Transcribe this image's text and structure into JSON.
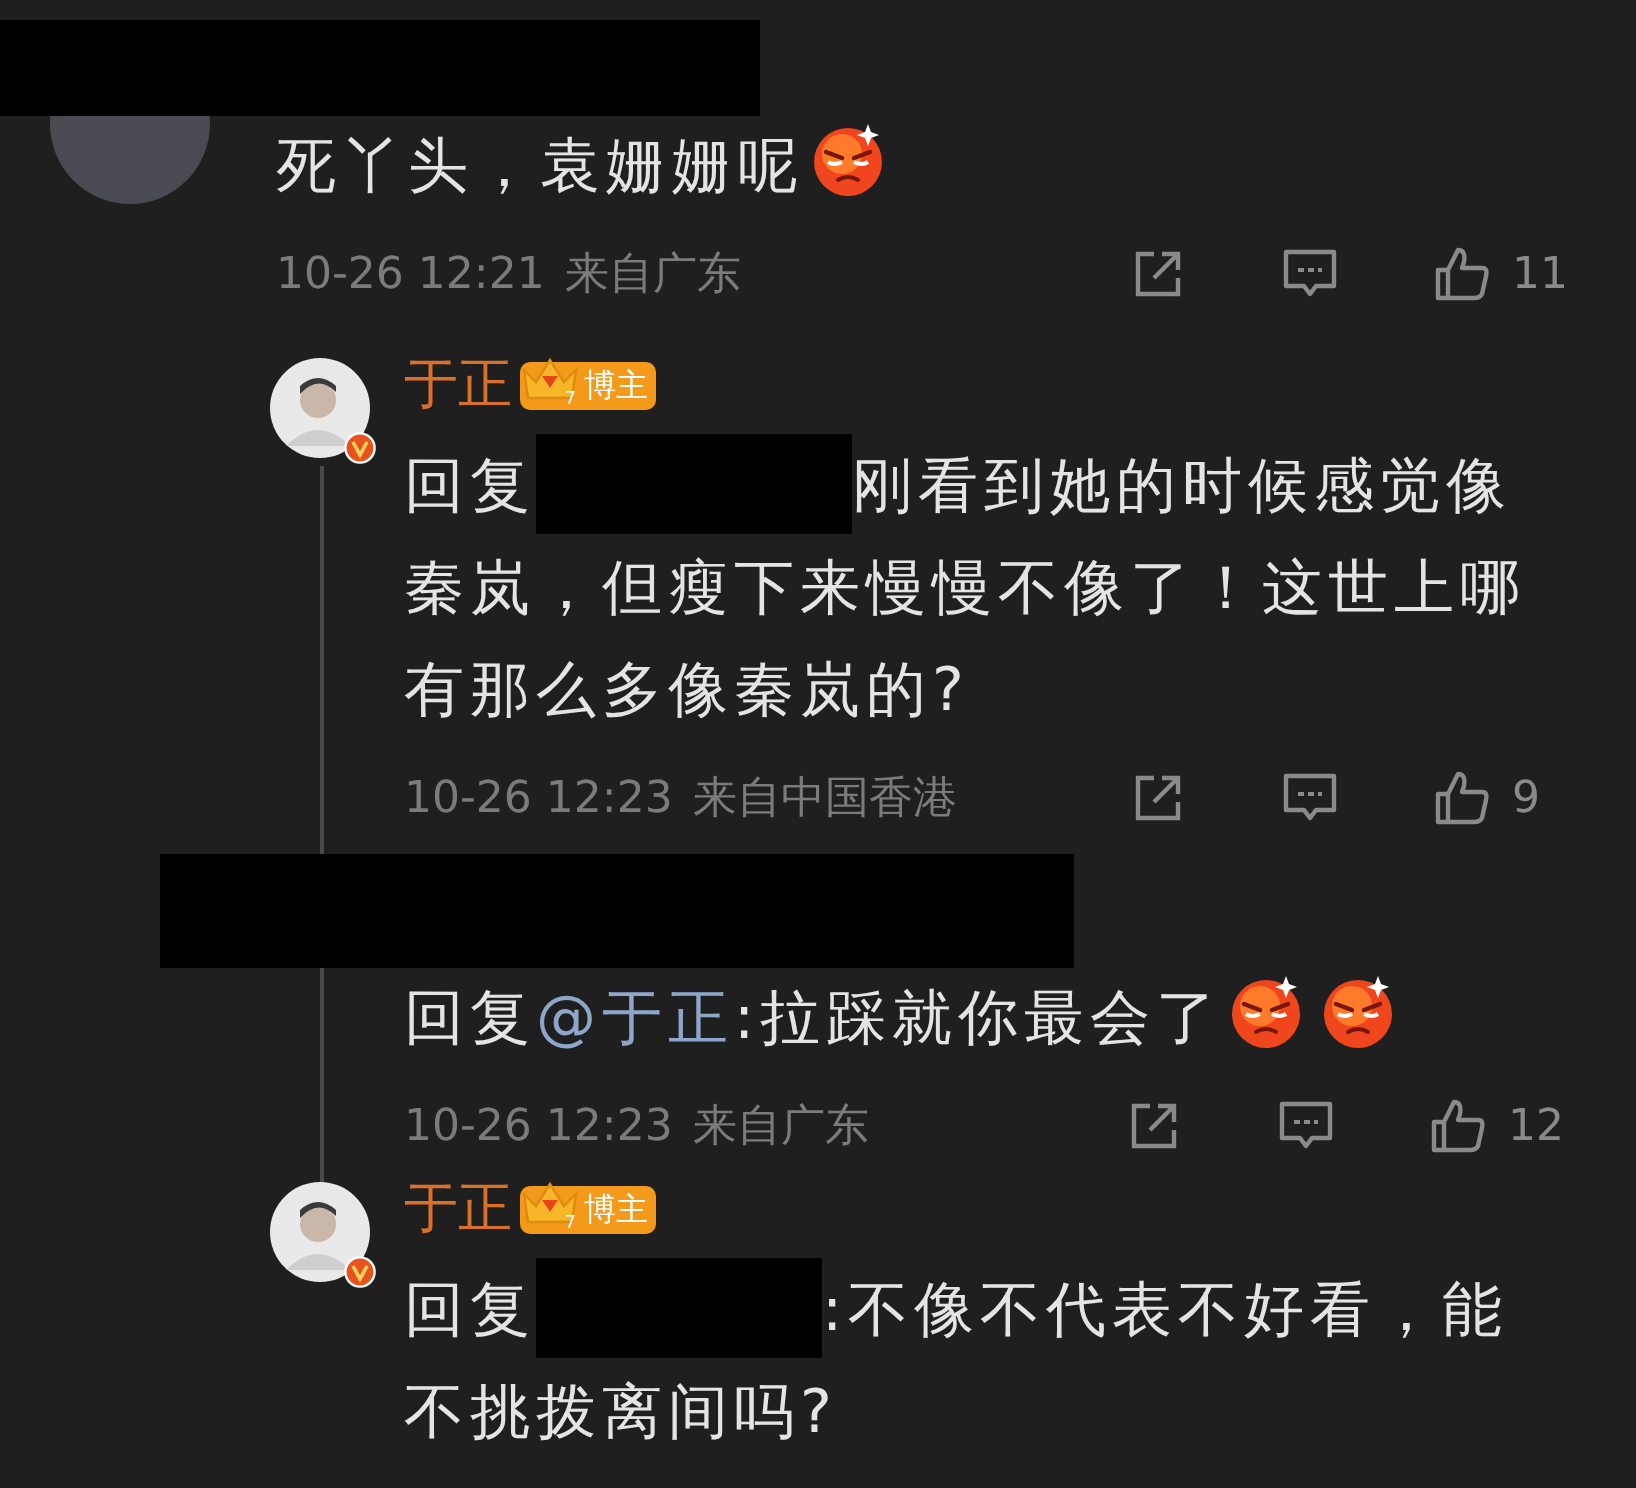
{
  "comment": {
    "author_redacted": true,
    "body": [
      [
        {
          "kind": "text",
          "text": "死丫头，袁姗姗呢"
        },
        {
          "kind": "emoji"
        }
      ]
    ],
    "time": "10-26 12:21",
    "location": "来自广东",
    "likes": "11"
  },
  "replies": [
    {
      "author_redacted": false,
      "author": "于正",
      "verified": true,
      "badge": {
        "level": "7",
        "label": "博主"
      },
      "body": [
        [
          {
            "kind": "text",
            "text": "回复"
          },
          {
            "kind": "redacted"
          },
          {
            "kind": "text",
            "text": "刚看到她的时候感觉像"
          }
        ],
        [
          {
            "kind": "text",
            "text": "秦岚，但瘦下来慢慢不像了！这世上哪有那么多像秦岚的?"
          }
        ]
      ],
      "time": "10-26 12:23",
      "location": "来自中国香港",
      "likes": "9"
    },
    {
      "author_redacted": true,
      "body": [
        [
          {
            "kind": "text",
            "text": "回复"
          },
          {
            "kind": "mention",
            "text": "@于正"
          },
          {
            "kind": "text",
            "text": ":拉踩就你最会了"
          },
          {
            "kind": "emoji"
          },
          {
            "kind": "emoji"
          }
        ]
      ],
      "time": "10-26 12:23",
      "location": "来自广东",
      "likes": "12"
    },
    {
      "author_redacted": false,
      "author": "于正",
      "verified": true,
      "badge": {
        "level": "7",
        "label": "博主"
      },
      "body": [
        [
          {
            "kind": "text",
            "text": "回复"
          },
          {
            "kind": "redacted"
          },
          {
            "kind": "text",
            "text": ":不像不代表不好看，能"
          }
        ],
        [
          {
            "kind": "text",
            "text": "不挑拨离间吗?"
          }
        ]
      ]
    }
  ]
}
